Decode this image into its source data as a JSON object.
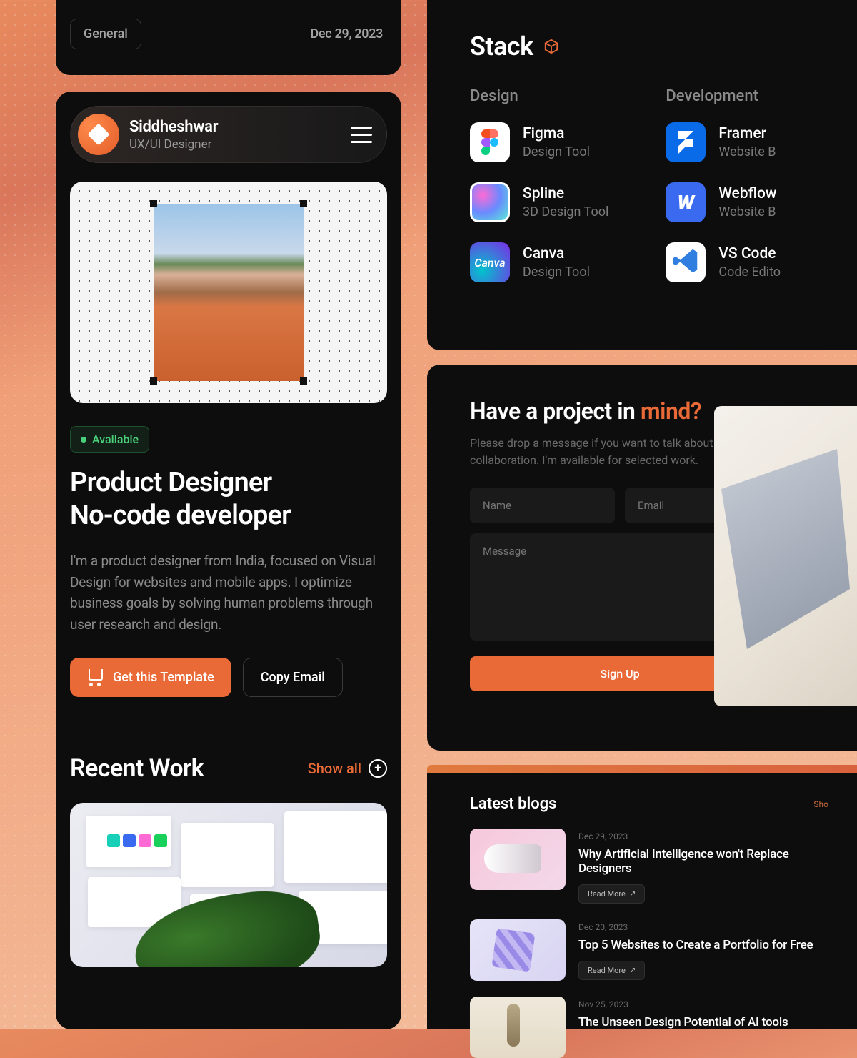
{
  "top_strip": {
    "tag": "General",
    "date": "Dec 29, 2023"
  },
  "profile": {
    "name": "Siddheshwar",
    "role": "UX/UI Designer"
  },
  "hero": {
    "available": "Available",
    "title1": "Product Designer",
    "title2": "No-code developer",
    "desc": "I'm a product designer from India, focused on Visual Design for websites and mobile apps. I optimize business goals by solving human problems through user research and design.",
    "primary_btn": "Get this Template",
    "secondary_btn": "Copy Email"
  },
  "recent": {
    "title": "Recent Work",
    "show_all": "Show all"
  },
  "stack": {
    "title": "Stack",
    "design_label": "Design",
    "dev_label": "Development",
    "design": [
      {
        "name": "Figma",
        "sub": "Design Tool"
      },
      {
        "name": "Spline",
        "sub": "3D Design Tool"
      },
      {
        "name": "Canva",
        "sub": "Design Tool"
      }
    ],
    "dev": [
      {
        "name": "Framer",
        "sub": "Website B"
      },
      {
        "name": "Webflow",
        "sub": "Website B"
      },
      {
        "name": "VS Code",
        "sub": "Code Edito"
      }
    ]
  },
  "contact": {
    "title_pre": "Have a project in ",
    "title_accent": "mind?",
    "sub": "Please drop a message if you want to talk about a potential collaboration. I'm available for selected work.",
    "name_ph": "Name",
    "email_ph": "Email",
    "msg_ph": "Message",
    "submit": "Sign Up"
  },
  "blogs": {
    "title": "Latest blogs",
    "show_all": "Sho",
    "read_more": "Read More",
    "items": [
      {
        "date": "Dec 29, 2023",
        "title": "Why Artificial Intelligence won't Replace Designers"
      },
      {
        "date": "Dec 20, 2023",
        "title": "Top 5 Websites to Create a Portfolio for Free"
      },
      {
        "date": "Nov 25, 2023",
        "title": "The Unseen Design Potential of AI tools"
      }
    ]
  }
}
